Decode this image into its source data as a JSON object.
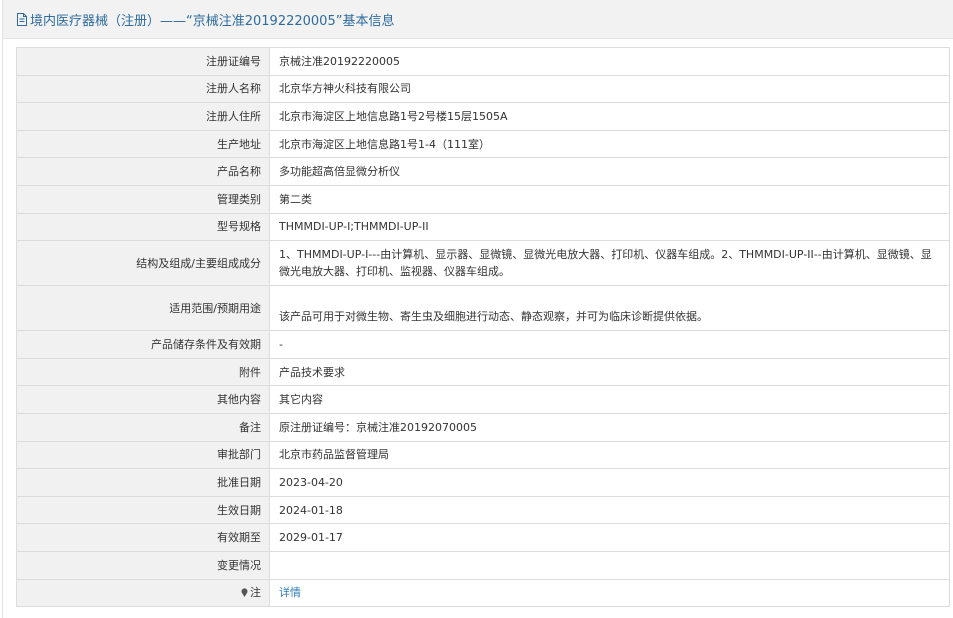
{
  "header": {
    "title": "境内医疗器械（注册）——“京械注准20192220005”基本信息",
    "icon": "document-icon"
  },
  "rows": [
    {
      "label": "注册证编号",
      "value": "京械注准20192220005"
    },
    {
      "label": "注册人名称",
      "value": "北京华方神火科技有限公司"
    },
    {
      "label": "注册人住所",
      "value": "北京市海淀区上地信息路1号2号楼15层1505A"
    },
    {
      "label": "生产地址",
      "value": "北京市海淀区上地信息路1号1-4（111室）"
    },
    {
      "label": "产品名称",
      "value": "多功能超高倍显微分析仪"
    },
    {
      "label": "管理类别",
      "value": "第二类"
    },
    {
      "label": "型号规格",
      "value": "THMMDI-UP-I;THMMDI-UP-II"
    },
    {
      "label": "结构及组成/主要组成成分",
      "value": "1、THMMDI-UP-I---由计算机、显示器、显微镜、显微光电放大器、打印机、仪器车组成。2、THMMDI-UP-II--由计算机、显微镜、显微光电放大器、打印机、监视器、仪器车组成。"
    },
    {
      "label": "适用范围/预期用途",
      "value": "该产品可用于对微生物、寄生虫及细胞进行动态、静态观察，并可为临床诊断提供依据。"
    },
    {
      "label": "产品储存条件及有效期",
      "value": "-"
    },
    {
      "label": "附件",
      "value": "产品技术要求"
    },
    {
      "label": "其他内容",
      "value": "其它内容"
    },
    {
      "label": "备注",
      "value": "原注册证编号：京械注准20192070005"
    },
    {
      "label": "审批部门",
      "value": "北京市药品监督管理局"
    },
    {
      "label": "批准日期",
      "value": "2023-04-20"
    },
    {
      "label": "生效日期",
      "value": "2024-01-18"
    },
    {
      "label": "有效期至",
      "value": "2029-01-17"
    },
    {
      "label": "变更情况",
      "value": ""
    },
    {
      "label": "注",
      "value": "详情",
      "icon": "pin-icon"
    }
  ]
}
